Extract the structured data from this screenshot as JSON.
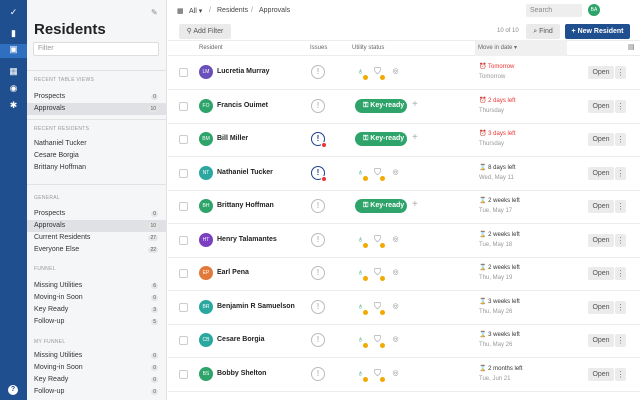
{
  "app": {
    "title": "Residents",
    "filter_placeholder": "Filter"
  },
  "topbar": {
    "all_label": "All",
    "breadcrumb_1": "Residents",
    "breadcrumb_sep": "/",
    "breadcrumb_2": "Approvals",
    "search_placeholder": "Search",
    "avatar": "BA",
    "add_filter": "Add Filter",
    "count": "10 of 10",
    "find": "Find",
    "new_resident": "+ New Resident"
  },
  "columns": {
    "resident": "Resident",
    "issues": "Issues",
    "utility": "Utility status",
    "move": "Move in date"
  },
  "sidebar": {
    "recent_views_label": "RECENT TABLE VIEWS",
    "recent_views": [
      {
        "label": "Prospects",
        "count": "0"
      },
      {
        "label": "Approvals",
        "count": "10"
      }
    ],
    "recent_residents_label": "RECENT RESIDENTS",
    "recent_residents": [
      "Nathaniel Tucker",
      "Cesare Borgia",
      "Brittany Hoffman"
    ],
    "general_label": "GENERAL",
    "general": [
      {
        "label": "Prospects",
        "count": "0"
      },
      {
        "label": "Approvals",
        "count": "10"
      },
      {
        "label": "Current Residents",
        "count": "27"
      },
      {
        "label": "Everyone Else",
        "count": "22"
      }
    ],
    "funnel_label": "FUNNEL",
    "funnel": [
      {
        "label": "Missing Utilities",
        "count": "6"
      },
      {
        "label": "Moving-in Soon",
        "count": "0"
      },
      {
        "label": "Key Ready",
        "count": "3"
      },
      {
        "label": "Follow-up",
        "count": "5"
      }
    ],
    "my_funnel_label": "MY FUNNEL",
    "my_funnel": [
      {
        "label": "Missing Utilities",
        "count": "0"
      },
      {
        "label": "Moving-in Soon",
        "count": "0"
      },
      {
        "label": "Key Ready",
        "count": "0"
      },
      {
        "label": "Follow-up",
        "count": "0"
      }
    ]
  },
  "rows": [
    {
      "initials": "LM",
      "name": "Lucretia Murray",
      "color": "#6b4fbb",
      "issue": "none",
      "utility": "icons",
      "move1": "Tomorrow",
      "move2": "Tomorrow",
      "urgent": true,
      "open": "Open"
    },
    {
      "initials": "FO",
      "name": "Francis Ouimet",
      "color": "#2ea36a",
      "issue": "none",
      "utility": "key",
      "move1": "2 days left",
      "move2": "Thursday",
      "urgent": true,
      "open": "Open"
    },
    {
      "initials": "BM",
      "name": "Bill Miller",
      "color": "#2ea36a",
      "issue": "red",
      "utility": "key",
      "move1": "3 days left",
      "move2": "Thursday",
      "urgent": true,
      "open": "Open"
    },
    {
      "initials": "NT",
      "name": "Nathaniel Tucker",
      "color": "#2aa8a0",
      "issue": "red",
      "utility": "icons",
      "move1": "8 days left",
      "move2": "Wed, May 11",
      "urgent": false,
      "open": "Open"
    },
    {
      "initials": "BH",
      "name": "Brittany Hoffman",
      "color": "#2ea36a",
      "issue": "none",
      "utility": "key",
      "move1": "2 weeks left",
      "move2": "Tue, May 17",
      "urgent": false,
      "open": "Open"
    },
    {
      "initials": "HT",
      "name": "Henry Talamantes",
      "color": "#7b3fc0",
      "issue": "none",
      "utility": "icons",
      "move1": "2 weeks left",
      "move2": "Tue, May 18",
      "urgent": false,
      "open": "Open"
    },
    {
      "initials": "EP",
      "name": "Earl Pena",
      "color": "#e0793a",
      "issue": "none",
      "utility": "icons",
      "move1": "2 weeks left",
      "move2": "Thu, May 19",
      "urgent": false,
      "open": "Open"
    },
    {
      "initials": "BR",
      "name": "Benjamin R Samuelson",
      "color": "#2aa8a0",
      "issue": "none",
      "utility": "icons",
      "move1": "3 weeks left",
      "move2": "Thu, May 26",
      "urgent": false,
      "open": "Open"
    },
    {
      "initials": "CB",
      "name": "Cesare Borgia",
      "color": "#2aa8a0",
      "issue": "none",
      "utility": "icons",
      "move1": "3 weeks left",
      "move2": "Thu, May 26",
      "urgent": false,
      "open": "Open"
    },
    {
      "initials": "BS",
      "name": "Bobby Shelton",
      "color": "#2ea36a",
      "issue": "none",
      "utility": "icons",
      "move1": "2 months left",
      "move2": "Tue, Jun 21",
      "urgent": false,
      "open": "Open"
    }
  ],
  "key_ready_label": "Key-ready",
  "icons": {
    "logo": "check-circle-icon",
    "dashboard": "chart-icon",
    "residents": "lock-icon",
    "building": "building-icon",
    "globe": "globe-icon",
    "settings": "gear-icon",
    "help": "help-icon",
    "colors": {
      "brand": "#1f4f8f",
      "accent": "#2ea36a",
      "alert": "#e33"
    }
  }
}
